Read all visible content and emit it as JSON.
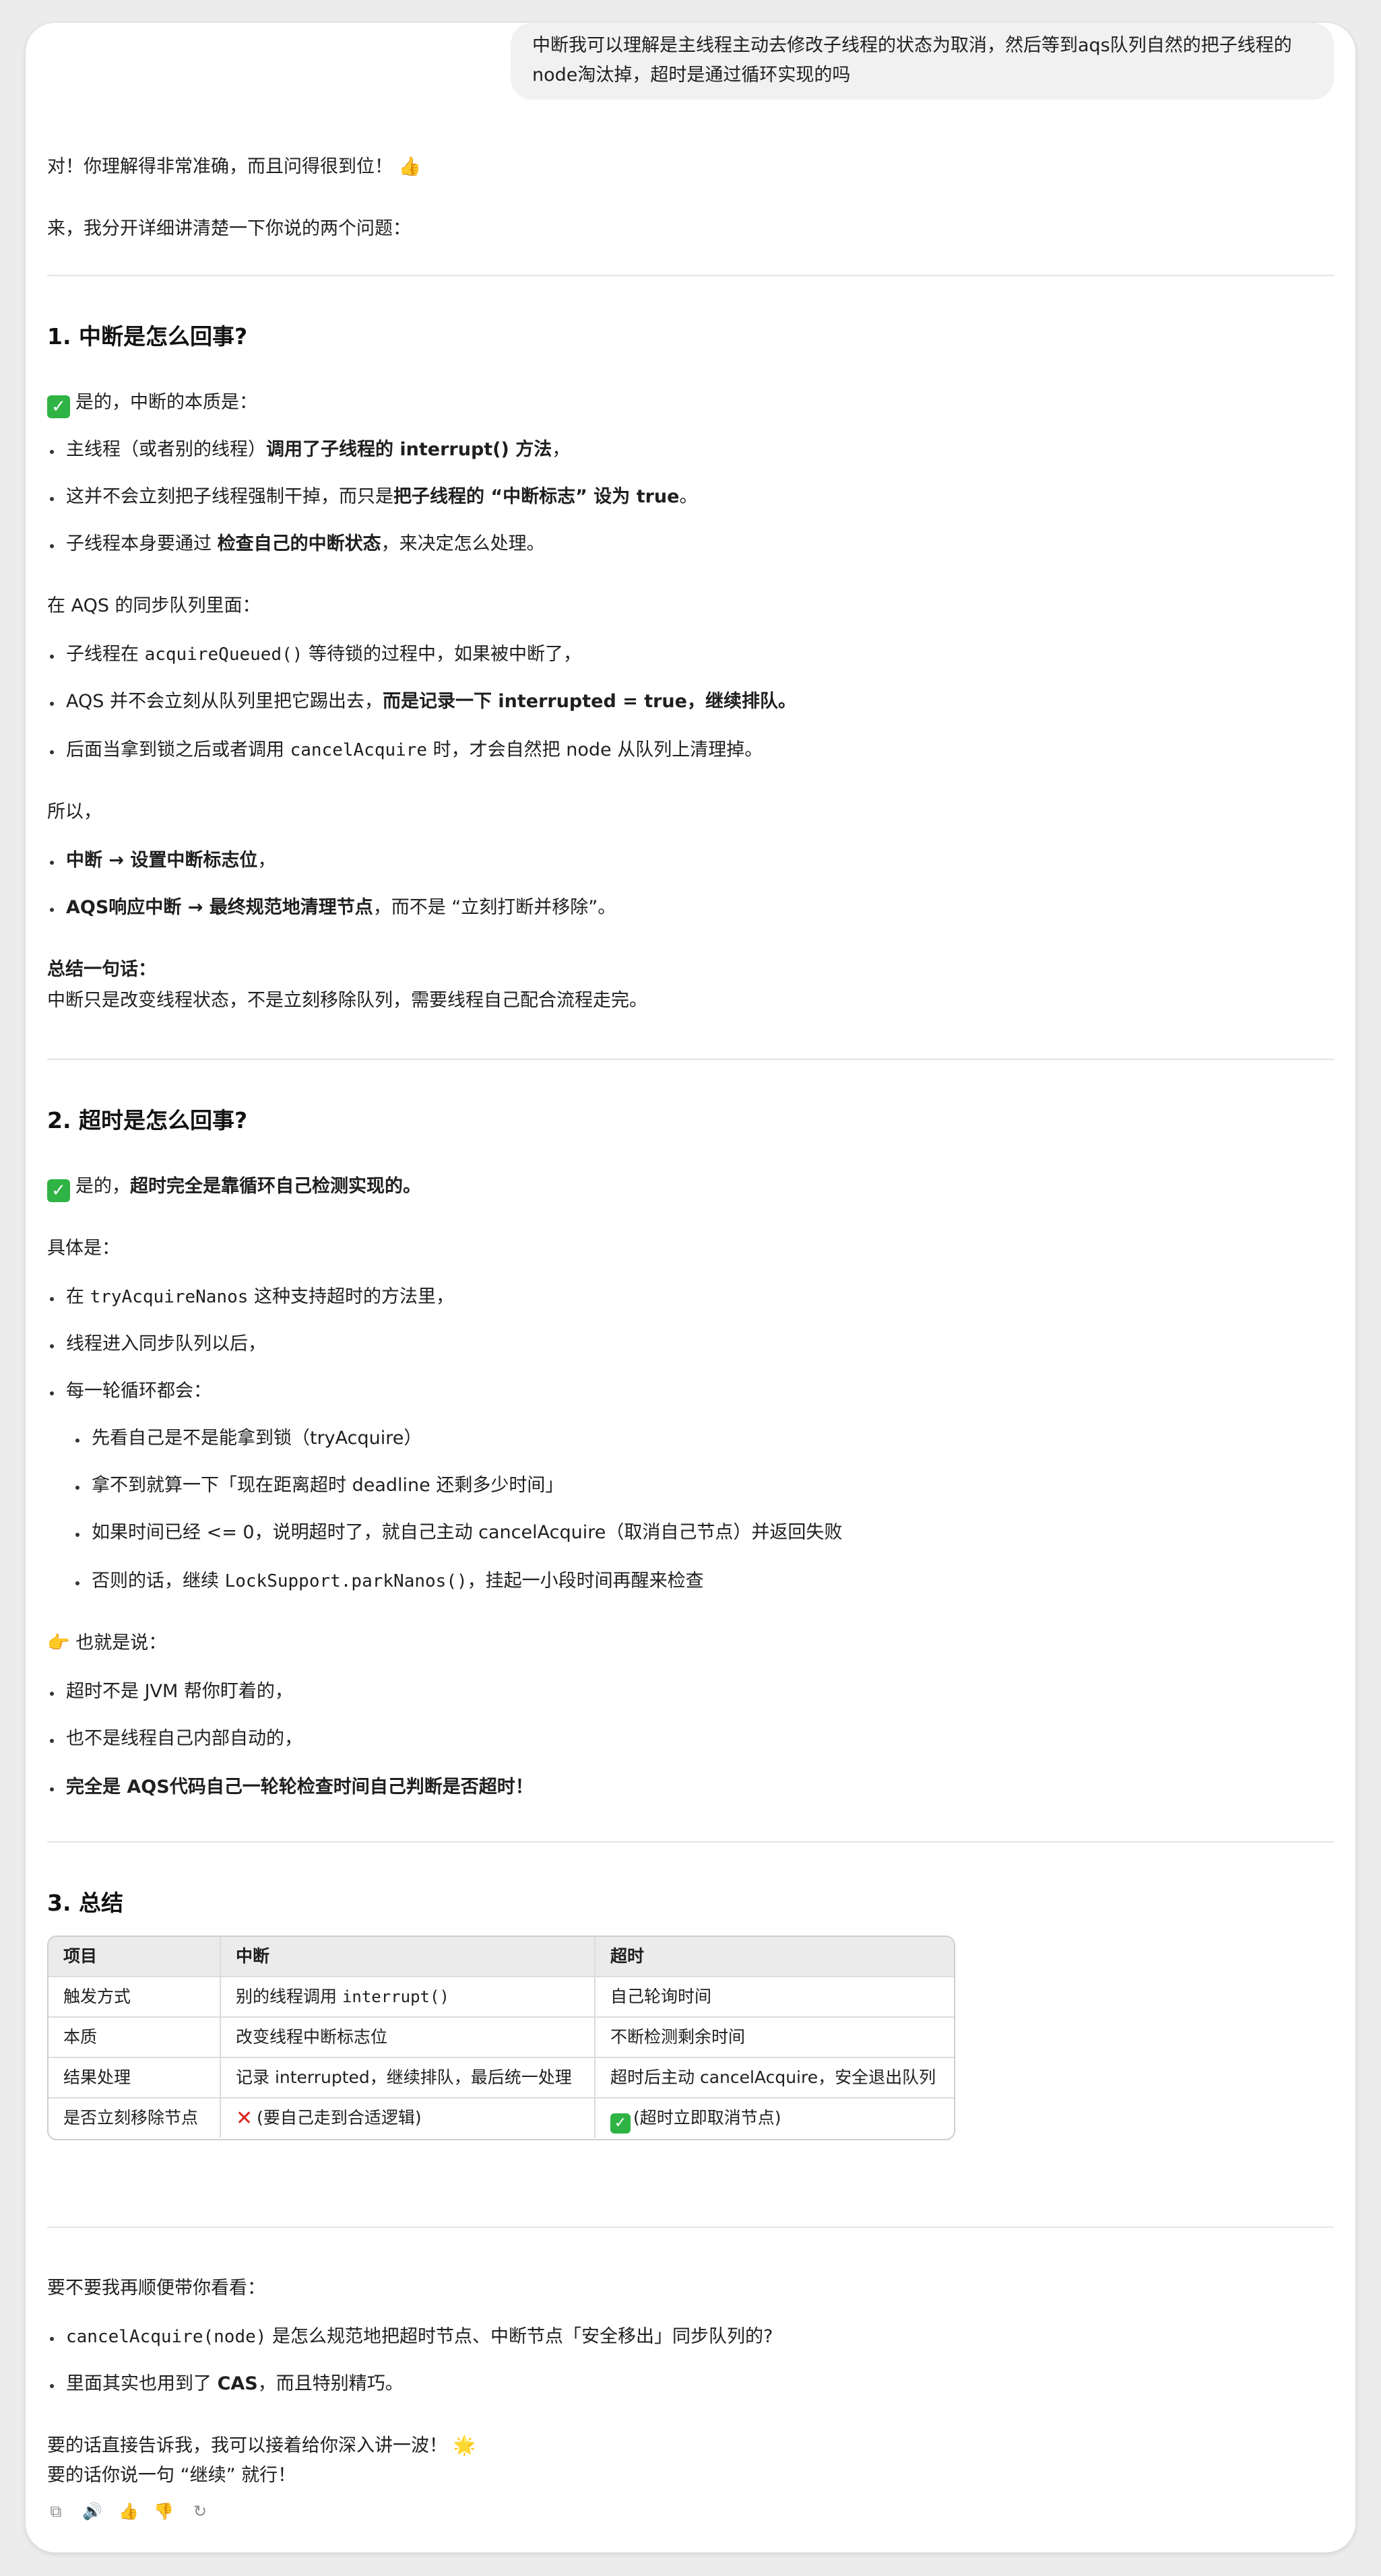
{
  "user_message": {
    "line1": "中断我可以理解是主线程主动去修改子线程的状态为取消，然后等到aqs队列自然的把子线程的",
    "line2": "node淘汰掉，超时是通过循环实现的吗"
  },
  "intro": {
    "p1": "对！你理解得非常准确，而且问得很到位！",
    "p1_emoji": "👍",
    "p2": "来，我分开详细讲清楚一下你说的两个问题："
  },
  "sec1": {
    "title": "1. 中断是怎么回事?",
    "lead": "是的，中断的本质是：",
    "b1_pre": "主线程（或者别的线程）",
    "b1_bold": "调用了子线程的 interrupt() 方法",
    "b1_post": "，",
    "b2_pre": "这并不会立刻把子线程强制干掉，而只是",
    "b2_bold": "把子线程的 “中断标志” 设为 true",
    "b2_post": "。",
    "b3_pre": "子线程本身要通过 ",
    "b3_bold": "检查自己的中断状态",
    "b3_post": "，来决定怎么处理。",
    "aqs_lead": "在 AQS 的同步队列里面：",
    "c1_pre": "子线程在 ",
    "c1_code": "acquireQueued()",
    "c1_post": " 等待锁的过程中，如果被中断了，",
    "c2_pre": "AQS 并不会立刻从队列里把它踢出去，",
    "c2_bold": "而是记录一下 interrupted = true，继续排队。",
    "c3_pre": "后面当拿到锁之后或者调用 ",
    "c3_code": "cancelAcquire",
    "c3_post": " 时，才会自然把 node 从队列上清理掉。",
    "so": "所以，",
    "d1_bold": "中断 → 设置中断标志位",
    "d1_post": "，",
    "d2_bold": "AQS响应中断 → 最终规范地清理节点",
    "d2_post": "，而不是 “立刻打断并移除”。",
    "summary_label": "总结一句话：",
    "summary_text": "中断只是改变线程状态，不是立刻移除队列，需要线程自己配合流程走完。"
  },
  "sec2": {
    "title": "2. 超时是怎么回事?",
    "lead_pre": "是的，",
    "lead_bold": "超时完全是靠循环自己检测实现的。",
    "detail": "具体是：",
    "e1_pre": "在 ",
    "e1_code": "tryAcquireNanos",
    "e1_post": " 这种支持超时的方法里，",
    "e2": "线程进入同步队列以后，",
    "e3": "每一轮循环都会：",
    "f1": "先看自己是不是能拿到锁（tryAcquire）",
    "f2": "拿不到就算一下「现在距离超时 deadline 还剩多少时间」",
    "f3": "如果时间已经 <= 0，说明超时了，就自己主动 cancelAcquire（取消自己节点）并返回失败",
    "f4_pre": "否则的话，继续 ",
    "f4_code": "LockSupport.parkNanos()",
    "f4_post": "，挂起一小段时间再醒来检查",
    "point_emoji": "👉",
    "that_is": "也就是说：",
    "g1": "超时不是 JVM 帮你盯着的，",
    "g2": "也不是线程自己内部自动的，",
    "g3_bold": "完全是 AQS代码自己一轮轮检查时间自己判断是否超时！"
  },
  "sec3": {
    "title": "3. 总结",
    "headers": [
      "项目",
      "中断",
      "超时"
    ],
    "rows": [
      {
        "c1": "触发方式",
        "c2_pre": "别的线程调用 ",
        "c2_code": "interrupt()",
        "c3": "自己轮询时间"
      },
      {
        "c1": "本质",
        "c2": "改变线程中断标志位",
        "c3": "不断检测剩余时间"
      },
      {
        "c1": "结果处理",
        "c2": "记录 interrupted，继续排队，最后统一处理",
        "c3": "超时后主动 cancelAcquire，安全退出队列"
      },
      {
        "c1": "是否立刻移除节点",
        "c2": "(要自己走到合适逻辑)",
        "c3": "(超时立即取消节点)"
      }
    ]
  },
  "followup": {
    "ask": "要不要我再顺便带你看看：",
    "h1_code": "cancelAcquire(node)",
    "h1_post": " 是怎么规范地把超时节点、中断节点「安全移出」同步队列的?",
    "h2_pre": "里面其实也用到了 ",
    "h2_bold": "CAS",
    "h2_post": "，而且特别精巧。",
    "end1": "要的话直接告诉我，我可以接着给你深入讲一波！",
    "end1_emoji": "🌟",
    "end2": "要的话你说一句 “继续” 就行！"
  },
  "toolbar": {
    "copy": "⧉",
    "speak": "🔊",
    "like": "👍",
    "dislike": "👎",
    "regen": "↻"
  },
  "colors": {
    "check_green": "#2fb344",
    "cross_red": "#d9231d",
    "bubble_bg": "#f1f1f1",
    "table_header_bg": "#ebebeb"
  }
}
